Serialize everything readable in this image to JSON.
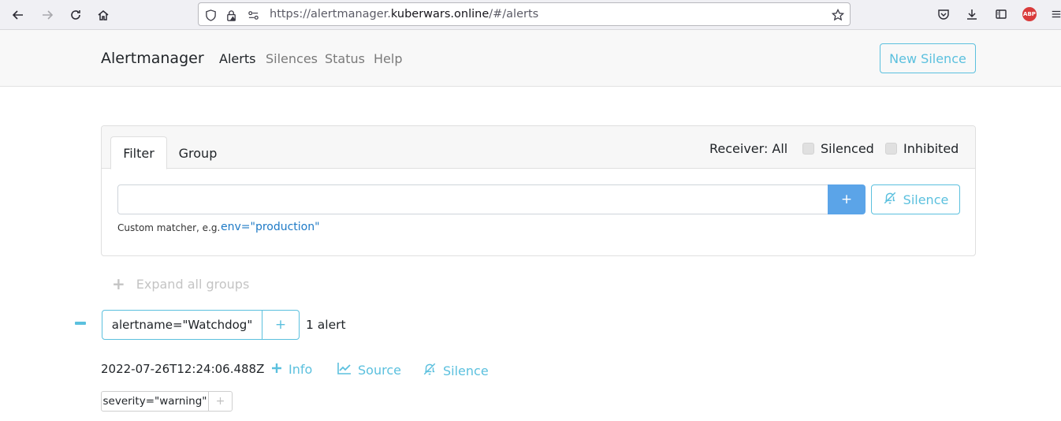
{
  "browser": {
    "url_prefix": "https://alertmanager.",
    "url_domain": "kuberwars.online",
    "url_suffix": "/#/alerts",
    "icons": [
      "back-icon",
      "forward-icon",
      "reload-icon",
      "home-icon",
      "shield-icon",
      "lock-warning-icon",
      "permissions-icon",
      "bookmark-star-icon",
      "pocket-icon",
      "download-icon",
      "reader-view-icon",
      "adblock-icon",
      "menu-icon"
    ],
    "adblock_badge": "ABP"
  },
  "navbar": {
    "brand": "Alertmanager",
    "links": [
      "Alerts",
      "Silences",
      "Status",
      "Help"
    ],
    "new_silence": "New Silence"
  },
  "filter_card": {
    "tabs": [
      "Filter",
      "Group"
    ],
    "receiver": "Receiver: All",
    "silenced_label": "Silenced",
    "inhibited_label": "Inhibited",
    "input_value": "",
    "plus_label": "+",
    "silence_label": "Silence",
    "hint": "Custom matcher, e.g.",
    "hint_example": "env=\"production\""
  },
  "expand_all": {
    "plus": "+",
    "label": "Expand all groups"
  },
  "group": {
    "label": "alertname=\"Watchdog\"",
    "add": "+",
    "count": "1 alert"
  },
  "alert": {
    "timestamp": "2022-07-26T12:24:06.488Z",
    "info": "Info",
    "source": "Source",
    "silence": "Silence",
    "label": "severity=\"warning\"",
    "label_add": "+"
  },
  "colors": {
    "accent": "#5bc0de",
    "primary": "#5ba4e8",
    "link": "#1e7ac6"
  }
}
